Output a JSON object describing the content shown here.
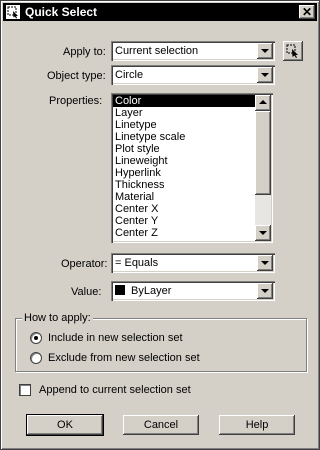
{
  "window": {
    "title": "Quick Select",
    "close_glyph": "✕"
  },
  "apply_to": {
    "label": "Apply to:",
    "value": "Current selection"
  },
  "object_type": {
    "label": "Object type:",
    "value": "Circle"
  },
  "properties": {
    "label": "Properties:",
    "items": [
      "Color",
      "Layer",
      "Linetype",
      "Linetype scale",
      "Plot style",
      "Lineweight",
      "Hyperlink",
      "Thickness",
      "Material",
      "Center X",
      "Center Y",
      "Center Z"
    ],
    "selected": "Color"
  },
  "operator": {
    "label": "Operator:",
    "value": "= Equals"
  },
  "value": {
    "label": "Value:",
    "value": "ByLayer",
    "swatch_color": "#000000"
  },
  "how_to_apply": {
    "title": "How to apply:",
    "options": [
      {
        "label": "Include in new selection set",
        "selected": true
      },
      {
        "label": "Exclude from new selection set",
        "selected": false
      }
    ]
  },
  "append": {
    "label": "Append to current selection set",
    "checked": false
  },
  "buttons": {
    "ok": "OK",
    "cancel": "Cancel",
    "help": "Help"
  },
  "colors": {
    "titlebar": "#000000",
    "dialog_bg": "#d4d0c8",
    "selection": "#000000"
  }
}
